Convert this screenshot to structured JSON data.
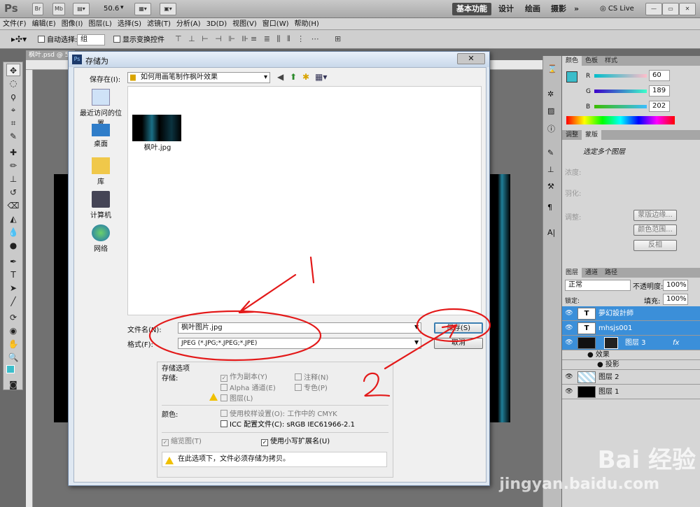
{
  "app": {
    "logo": "Ps",
    "zoom": "50.6",
    "workspaces": [
      "基本功能",
      "设计",
      "绘画",
      "摄影"
    ],
    "more": "»",
    "cslive": "CS Live"
  },
  "menu": [
    "文件(F)",
    "编辑(E)",
    "图像(I)",
    "图层(L)",
    "选择(S)",
    "滤镜(T)",
    "分析(A)",
    "3D(D)",
    "视图(V)",
    "窗口(W)",
    "帮助(H)"
  ],
  "options": {
    "auto_select": "自动选择:",
    "auto_select_value": "组",
    "show_transform": "显示变换控件"
  },
  "doc_tab": "枫叶.psd @ 5",
  "color_panel": {
    "tabs": [
      "颜色",
      "色板",
      "样式"
    ],
    "r_label": "R",
    "r": "60",
    "g_label": "G",
    "g": "189",
    "b_label": "B",
    "b": "202",
    "fg": "#3cbdca"
  },
  "adjust_panel": {
    "tabs": [
      "调整",
      "蒙版"
    ],
    "title": "选定多个图层",
    "density": "浓度:",
    "feather": "羽化:",
    "refine": "调整:",
    "btn_edge": "蒙版边缘...",
    "btn_color": "颜色范围...",
    "btn_invert": "反相"
  },
  "layers_panel": {
    "tabs": [
      "图层",
      "通道",
      "路径"
    ],
    "blend": "正常",
    "opacity_label": "不透明度:",
    "opacity": "100%",
    "lock_label": "锁定:",
    "fill_label": "填充:",
    "fill": "100%",
    "layers": [
      {
        "name": "夢幻設計師",
        "thumb": "T",
        "sel": true
      },
      {
        "name": "mhsjs001",
        "thumb": "T",
        "sel": true
      },
      {
        "name": "图层 3",
        "thumb": "",
        "sel": true,
        "fx": "fx"
      },
      {
        "name": "效果",
        "sub": true
      },
      {
        "name": "投影",
        "sub": true
      },
      {
        "name": "图层 2",
        "thumb": ""
      },
      {
        "name": "图层 1",
        "thumb": ""
      }
    ]
  },
  "dialog": {
    "title": "存储为",
    "ps": "Ps",
    "save_in_label": "保存在(I):",
    "save_in": "如何用画笔制作枫叶效果",
    "places": [
      "最近访问的位置",
      "桌面",
      "库",
      "计算机",
      "网络"
    ],
    "file": "枫叶.jpg",
    "filename_label": "文件名(N):",
    "filename": "枫叶图片.jpg",
    "format_label": "格式(F):",
    "format": "JPEG (*.JPG;*.JPEG;*.JPE)",
    "save_btn": "保存(S)",
    "cancel_btn": "取消",
    "options_title": "存储选项",
    "store_label": "存储:",
    "as_copy": "作为副本(Y)",
    "notes": "注释(N)",
    "alpha": "Alpha 通道(E)",
    "spot": "专色(P)",
    "layers": "图层(L)",
    "color_label": "颜色:",
    "proof": "使用校样设置(O):",
    "proof_val": "工作中的 CMYK",
    "icc": "ICC 配置文件(C):",
    "icc_val": "sRGB IEC61966-2.1",
    "thumbnail": "缩览图(T)",
    "lowercase": "使用小写扩展名(U)",
    "warning": "在此选项下，文件必须存储为拷贝。"
  },
  "annotations": {
    "one": "1",
    "two": "2"
  },
  "watermark": {
    "brand": "Bai 经验",
    "url": "jingyan.baidu.com"
  }
}
